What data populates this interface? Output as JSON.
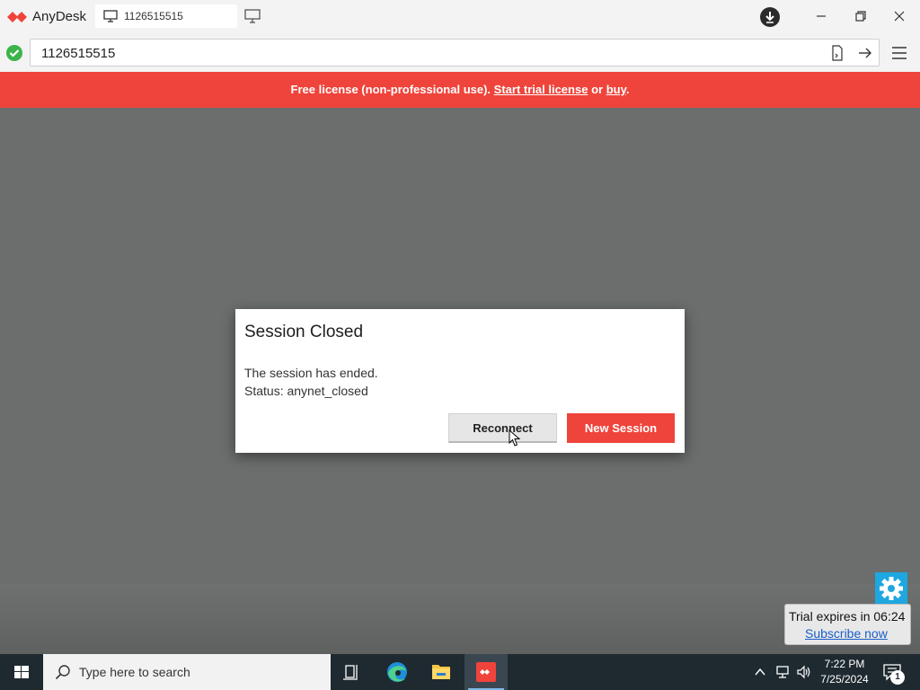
{
  "app": {
    "name": "AnyDesk"
  },
  "tab": {
    "label": "1126515515"
  },
  "address": {
    "value": "1126515515"
  },
  "banner": {
    "prefix": "Free license (non-professional use).",
    "trial_link": "Start trial license",
    "or": "or",
    "buy_link": "buy",
    "suffix": "."
  },
  "dialog": {
    "title": "Session Closed",
    "line1": "The session has ended.",
    "line2": "Status: anynet_closed",
    "reconnect_label": "Reconnect",
    "new_session_label": "New Session"
  },
  "trial": {
    "text": "Trial expires in 06:24",
    "link": "Subscribe now"
  },
  "taskbar": {
    "search_placeholder": "Type here to search",
    "time": "7:22 PM",
    "date": "7/25/2024",
    "notification_count": "1"
  },
  "colors": {
    "accent": "#ef443b",
    "session_bg": "#6b6e6d",
    "taskbar": "#1f2a30",
    "check": "#3cb44a",
    "gear": "#1ea7e0"
  }
}
